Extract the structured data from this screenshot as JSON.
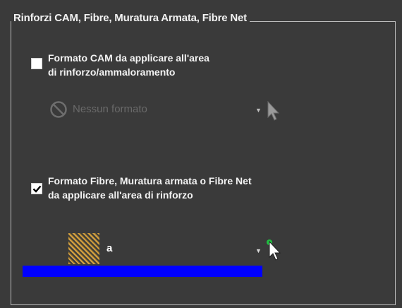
{
  "group": {
    "title": "Rinforzi CAM, Fibre, Muratura Armata, Fibre Net"
  },
  "cam": {
    "checked": false,
    "label_line1": "Formato CAM da applicare all'area",
    "label_line2": "di rinforzo/ammaloramento",
    "combo_value": "Nessun formato"
  },
  "fibre": {
    "checked": true,
    "label_line1": "Formato Fibre, Muratura armata o Fibre Net",
    "label_line2": "da applicare all'area di rinforzo",
    "combo_value": "a"
  },
  "colors": {
    "background": "#3a3a3a",
    "selection_bar": "#0000ff",
    "pointer_active": "#20c040"
  }
}
